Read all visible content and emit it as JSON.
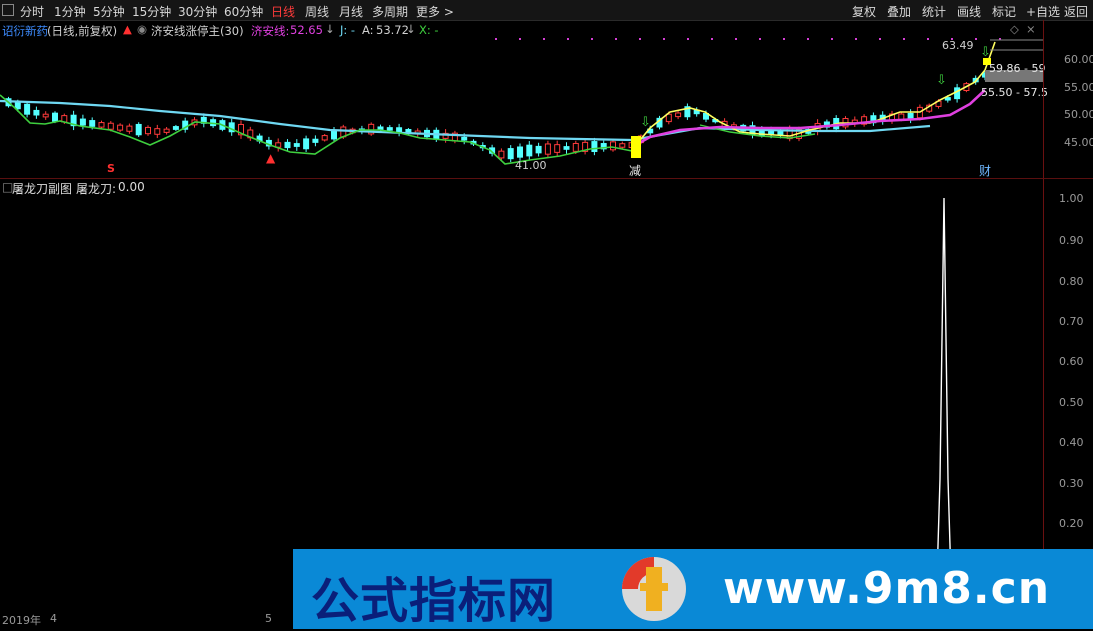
{
  "toolbar": {
    "left": [
      "分时",
      "1分钟",
      "5分钟",
      "15分钟",
      "30分钟",
      "60分钟",
      "日线",
      "周线",
      "月线",
      "多周期",
      "更多 >"
    ],
    "active": "日线",
    "right": [
      "复权",
      "叠加",
      "统计",
      "画线",
      "标记",
      "+自选",
      "返回"
    ]
  },
  "main_info": {
    "stock": "诏衍新药",
    "period": "(日线,前复权)",
    "indicator": "济安线涨停主(30)",
    "jaline_label": "济安线:",
    "jaline_value": "52.65",
    "j_label": "J: -",
    "a_label": "A:",
    "a_value": "53.72",
    "x_label": "X: -"
  },
  "price_axis": [
    "60.00",
    "55.00",
    "50.00",
    "45.00"
  ],
  "main_marks": {
    "high": "63.49",
    "low": "41.00",
    "range1": "59.86 - 59",
    "range2": "55.50 - 57.5",
    "sig_s": "S",
    "sig_jian": "减",
    "sig_cai": "财"
  },
  "sub_info": {
    "name": "屠龙刀副图",
    "label": "屠龙刀:",
    "value": "0.00"
  },
  "sub_axis": [
    "1.00",
    "0.90",
    "0.80",
    "0.70",
    "0.60",
    "0.50",
    "0.40",
    "0.30",
    "0.20"
  ],
  "date_axis": {
    "year": "2019年",
    "m1": "4",
    "m2": "5"
  },
  "banner": {
    "cn": "公式指标网",
    "url": "www.9m8.cn"
  },
  "colors": {
    "up": "#ff3b3b",
    "down": "#54ffff",
    "cyan_line": "#6fd8f2",
    "green_line": "#3ecf3e",
    "magenta_line": "#e040e0",
    "yellow_line": "#ffff60",
    "banner_blue": "#0a89d6"
  }
}
